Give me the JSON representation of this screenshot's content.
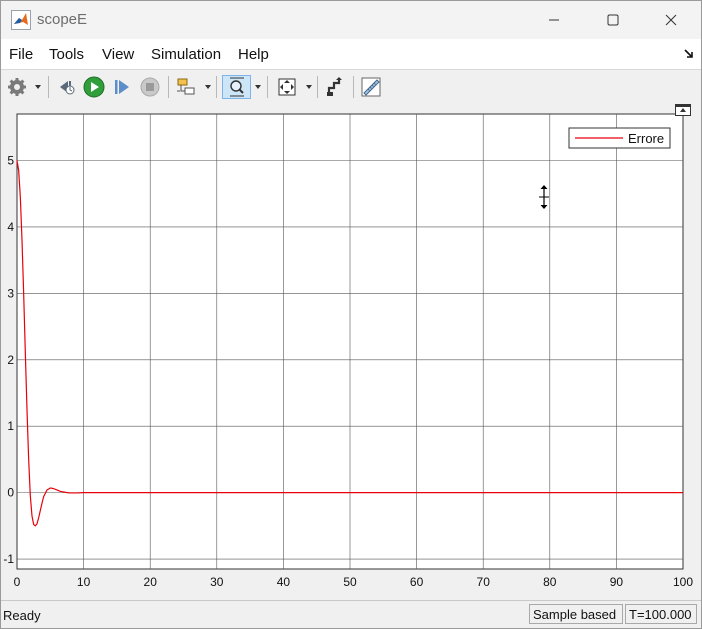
{
  "window": {
    "title": "scopeE",
    "icon": "matlab-logo-icon",
    "controls": [
      "minimize-icon",
      "maximize-icon",
      "close-icon"
    ]
  },
  "menu": {
    "items": [
      "File",
      "Tools",
      "View",
      "Simulation",
      "Help"
    ]
  },
  "toolbar": {
    "icons": [
      "settings-gear-icon",
      "step-back-icon",
      "run-icon",
      "step-forward-icon",
      "stop-icon",
      "signal-select-icon",
      "zoom-icon",
      "autoscale-icon",
      "highlight-block-icon",
      "measurements-ruler-icon"
    ],
    "active": "zoom-icon"
  },
  "chart_data": {
    "type": "line",
    "xlim": [
      0,
      100
    ],
    "ylim": [
      -1.15,
      5.7
    ],
    "xticks": [
      0,
      10,
      20,
      30,
      40,
      50,
      60,
      70,
      80,
      90,
      100
    ],
    "yticks": [
      -1,
      0,
      1,
      2,
      3,
      4,
      5
    ],
    "grid": true,
    "legend": {
      "position": "top-right",
      "entries": [
        "Errore"
      ]
    },
    "series": [
      {
        "name": "Errore",
        "color": "#e8000b",
        "x": [
          0,
          0.25,
          0.5,
          0.75,
          1.0,
          1.25,
          1.5,
          1.75,
          2.0,
          2.25,
          2.5,
          2.75,
          3.0,
          3.25,
          3.5,
          3.75,
          4.0,
          4.5,
          5.0,
          5.5,
          6.0,
          6.5,
          7.0,
          7.5,
          8.0,
          9.0,
          10.0,
          12.0,
          15.0,
          20.0,
          30.0,
          40.0,
          50.0,
          60.0,
          70.0,
          80.0,
          90.0,
          100.0
        ],
        "y": [
          5.0,
          4.85,
          4.45,
          3.8,
          3.0,
          2.1,
          1.25,
          0.5,
          -0.05,
          -0.35,
          -0.48,
          -0.5,
          -0.47,
          -0.38,
          -0.27,
          -0.16,
          -0.06,
          0.04,
          0.07,
          0.06,
          0.04,
          0.02,
          0.01,
          0.0,
          -0.005,
          -0.005,
          0.0,
          0.0,
          0.0,
          0.0,
          0.0,
          0.0,
          0.0,
          0.0,
          0.0,
          0.0,
          0.0,
          0.0
        ]
      }
    ]
  },
  "status": {
    "left": "Ready",
    "mode": "Sample based",
    "time": "T=100.000"
  }
}
